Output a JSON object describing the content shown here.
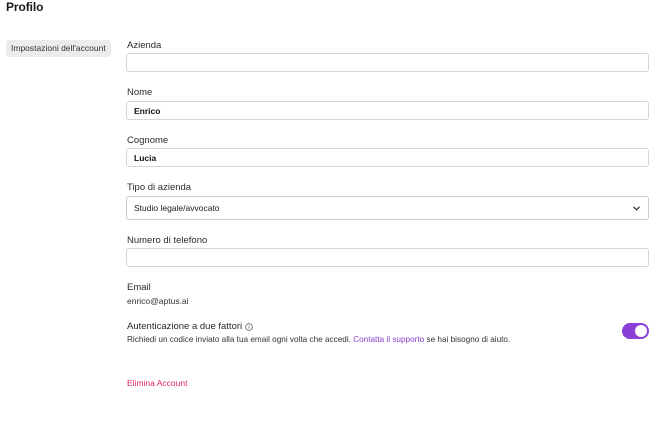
{
  "page": {
    "title": "Profilo"
  },
  "sidebar": {
    "items": [
      {
        "label": "Impostazioni dell'account"
      }
    ]
  },
  "form": {
    "company": {
      "label": "Azienda",
      "value": "",
      "placeholder": ""
    },
    "first_name": {
      "label": "Nome",
      "value": "Enrico"
    },
    "last_name": {
      "label": "Cognome",
      "value": "Lucia"
    },
    "company_type": {
      "label": "Tipo di azienda",
      "selected": "Studio legale/avvocato"
    },
    "phone": {
      "label": "Numero di telefono",
      "value": ""
    },
    "email": {
      "label": "Email",
      "value": "enrico@aptus.ai"
    },
    "two_factor": {
      "label": "Autenticazione a due fattori",
      "desc_before": "Richiedi un codice inviato alla tua email ogni volta che accedi.",
      "support_link": "Contatta il supporto",
      "desc_after": "se hai bisogno di aiuto.",
      "enabled": true
    },
    "delete_account": "Elimina Account"
  },
  "icons": {
    "info": "info-icon",
    "chevron": "chevron-down-icon"
  },
  "colors": {
    "accent": "#8b3fd6",
    "danger": "#e0245e",
    "link": "#8a3fd1"
  }
}
